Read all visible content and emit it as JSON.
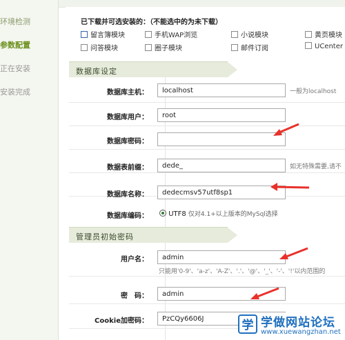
{
  "sidebar": {
    "steps": [
      {
        "label": "环境检测",
        "state": "done"
      },
      {
        "label": "参数配置",
        "state": "current"
      },
      {
        "label": "正在安装",
        "state": "pending"
      },
      {
        "label": "安装完成",
        "state": "pending"
      }
    ]
  },
  "modules": {
    "title": "已下载并可选安装的：（不能选中的为未下载）",
    "items": [
      {
        "label": "留言簿模块"
      },
      {
        "label": "手机WAP浏览"
      },
      {
        "label": "小说模块"
      },
      {
        "label": "黄页模块"
      },
      {
        "label": "问答模块"
      },
      {
        "label": "圈子模块"
      },
      {
        "label": "邮件订阅"
      },
      {
        "label": "UCenter"
      }
    ]
  },
  "db": {
    "section_title": "数据库设定",
    "host_label": "数据库主机：",
    "host_value": "localhost",
    "host_hint": "一般为localhost",
    "user_label": "数据库用户：",
    "user_value": "root",
    "password_label": "数据库密码：",
    "password_value": "",
    "prefix_label": "数据表前缀：",
    "prefix_value": "dede_",
    "prefix_hint": "如无特殊需要,请不",
    "name_label": "数据库名称：",
    "name_value": "dedecmsv57utf8sp1",
    "encoding_label": "数据库编码：",
    "encoding_value": "UTF8",
    "encoding_hint": "仅对4.1+以上版本的MySql选择"
  },
  "admin": {
    "section_title": "管理员初始密码",
    "username_label": "用户名：",
    "username_value": "admin",
    "username_hint": "只能用'0-9'、'a-z'、'A-Z'、'.'、'@'、'_'、'-'、'!'以内范围的",
    "password_label": "密　码：",
    "password_value": "admin",
    "cookie_label": "Cookie加密码：",
    "cookie_value": "PzCQy6606J"
  },
  "watermark": {
    "logo_char": "学",
    "title": "学做网站论坛",
    "url": "www.xuewangzhan.net"
  },
  "colors": {
    "annotation_arrow": "#e8312a",
    "sidebar_current": "#6b8f1a",
    "watermark_blue": "#1f6fbf"
  }
}
